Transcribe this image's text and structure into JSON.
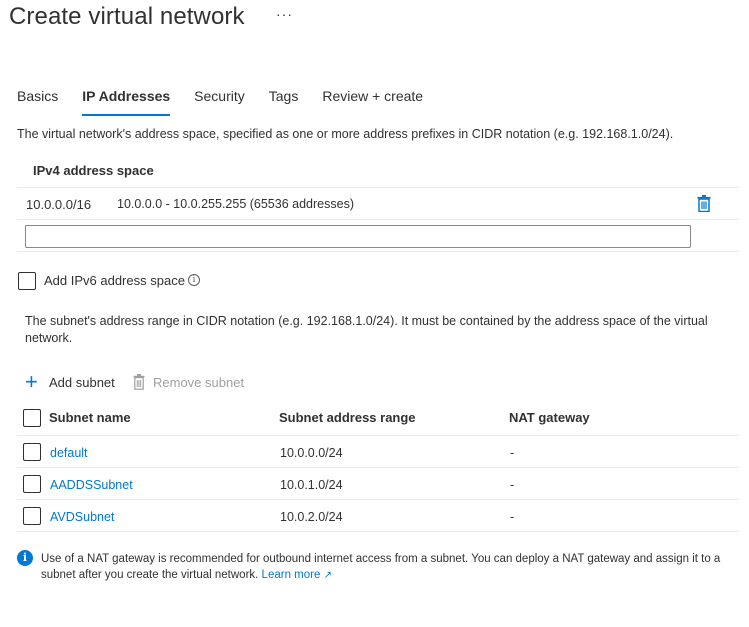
{
  "header": {
    "title": "Create virtual network",
    "more": "···"
  },
  "tabs": [
    {
      "label": "Basics",
      "active": false
    },
    {
      "label": "IP Addresses",
      "active": true
    },
    {
      "label": "Security",
      "active": false
    },
    {
      "label": "Tags",
      "active": false
    },
    {
      "label": "Review + create",
      "active": false
    }
  ],
  "address_space": {
    "description": "The virtual network's address space, specified as one or more address prefixes in CIDR notation (e.g. 192.168.1.0/24).",
    "header": "IPv4 address space",
    "entries": [
      {
        "cidr": "10.0.0.0/16",
        "range": "10.0.0.0 - 10.0.255.255 (65536 addresses)"
      }
    ],
    "new_input_value": "",
    "delete_icon": "trash-icon"
  },
  "ipv6": {
    "label": "Add IPv6 address space",
    "checked": false,
    "info_icon": "info-icon"
  },
  "subnets": {
    "description": "The subnet's address range in CIDR notation (e.g. 192.168.1.0/24). It must be contained by the address space of the virtual network.",
    "add_label": "Add subnet",
    "remove_label": "Remove subnet",
    "columns": {
      "name": "Subnet name",
      "range": "Subnet address range",
      "nat": "NAT gateway"
    },
    "rows": [
      {
        "name": "default",
        "range": "10.0.0.0/24",
        "nat": "-"
      },
      {
        "name": "AADDSSubnet",
        "range": "10.0.1.0/24",
        "nat": "-"
      },
      {
        "name": "AVDSubnet",
        "range": "10.0.2.0/24",
        "nat": "-"
      }
    ]
  },
  "info_banner": {
    "text": "Use of a NAT gateway is recommended for outbound internet access from a subnet. You can deploy a NAT gateway and assign it to a subnet after you create the virtual network.",
    "link": "Learn more",
    "icon": "info-icon"
  },
  "colors": {
    "accent": "#0078d4",
    "text": "#323130",
    "disabled": "#a19f9d",
    "divider": "#edebe9"
  }
}
